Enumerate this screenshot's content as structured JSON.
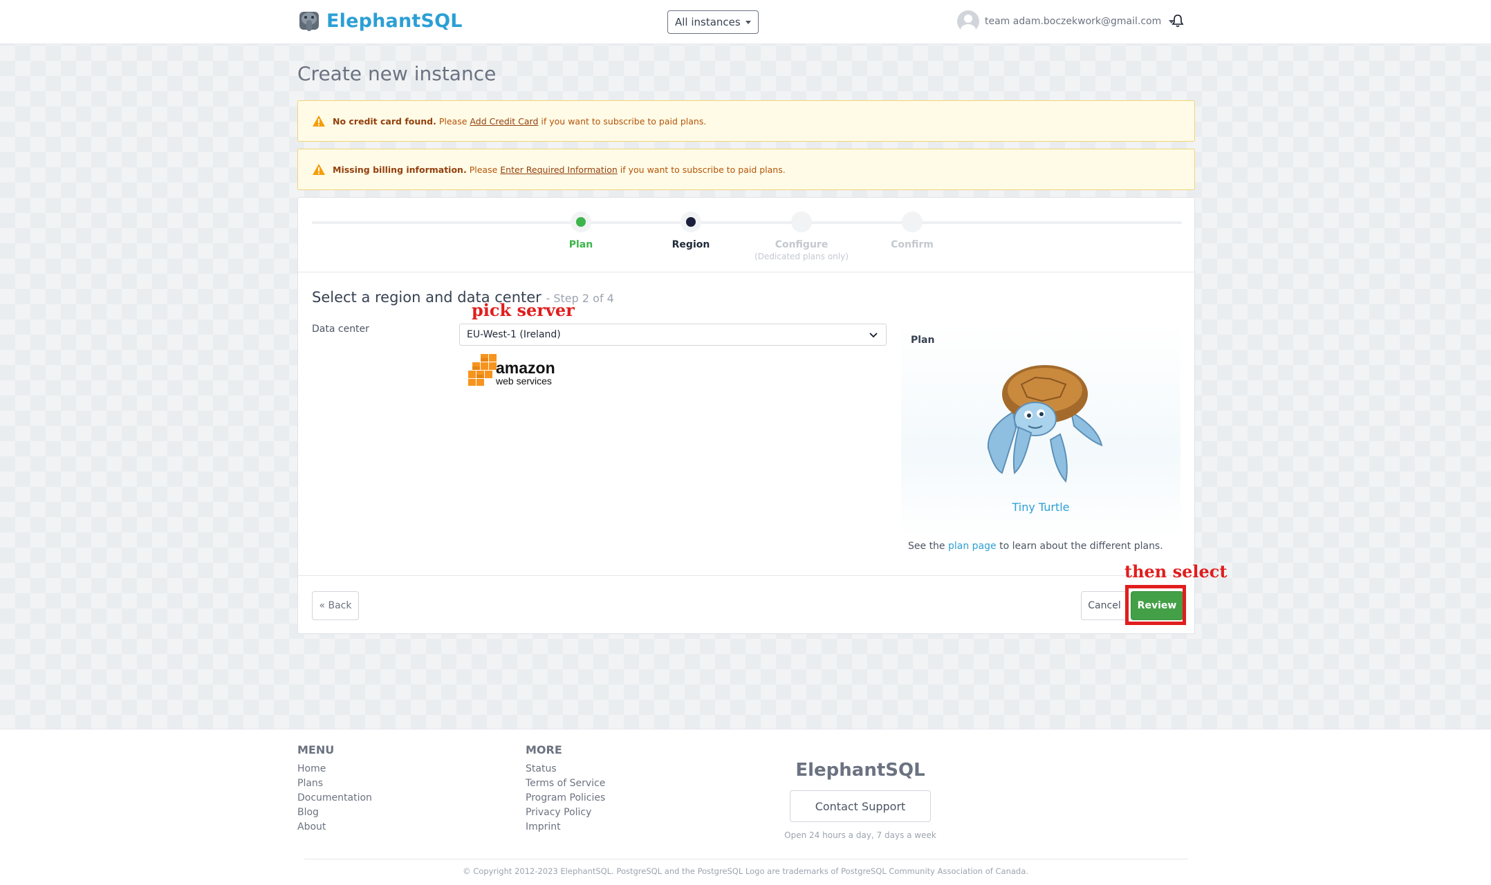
{
  "navbar": {
    "brand": "ElephantSQL",
    "instances_button": "All instances",
    "user_label": "team adam.boczekwork@gmail.com"
  },
  "page": {
    "title": "Create new instance"
  },
  "alerts": [
    {
      "bold": "No credit card found.",
      "pre": "Please",
      "link": "Add Credit Card",
      "post": "if you want to subscribe to paid plans."
    },
    {
      "bold": "Missing billing information.",
      "pre": "Please",
      "link": "Enter Required Information",
      "post": "if you want to subscribe to paid plans."
    }
  ],
  "steps": [
    {
      "label": "Plan",
      "sub": "",
      "state": "done"
    },
    {
      "label": "Region",
      "sub": "",
      "state": "active"
    },
    {
      "label": "Configure",
      "sub": "(Dedicated plans only)",
      "state": "pending"
    },
    {
      "label": "Confirm",
      "sub": "",
      "state": "pending"
    }
  ],
  "region_form": {
    "title": "Select a region and data center",
    "step_count": "- Step 2 of 4",
    "data_center_label": "Data center",
    "data_center_value": "EU-West-1 (Ireland)",
    "provider_logo": "amazon web services"
  },
  "plan": {
    "label": "Plan",
    "name": "Tiny Turtle",
    "note_pre": "See the",
    "note_link": "plan page",
    "note_post": "to learn about the different plans."
  },
  "buttons": {
    "back": "« Back",
    "cancel": "Cancel",
    "review": "Review"
  },
  "annotations": {
    "pick_server": "pick  server",
    "then_select": "then  select"
  },
  "footer": {
    "menu_title": "MENU",
    "menu_links": [
      "Home",
      "Plans",
      "Documentation",
      "Blog",
      "About"
    ],
    "more_title": "MORE",
    "more_links": [
      "Status",
      "Terms of Service",
      "Program Policies",
      "Privacy Policy",
      "Imprint"
    ],
    "brand": "ElephantSQL",
    "support_button": "Contact Support",
    "support_hours": "Open 24 hours a day, 7 days a week",
    "copyright": "© Copyright 2012-2023 ElephantSQL. PostgreSQL and the PostgreSQL Logo are trademarks of PostgreSQL Community Association of Canada."
  },
  "colors": {
    "brand_blue": "#2c9fd5",
    "success_green": "#3cb54a",
    "review_green": "#43a047",
    "active_step": "#1c1f3b",
    "annotation_red": "#e11d1d"
  },
  "icons": {
    "brand_logo": "elephant-icon",
    "bell": "bell-icon",
    "avatar": "user-avatar-icon",
    "warning": "warning-triangle-icon",
    "select": "chevron-down-icon",
    "plan_mascot": "turtle-icon"
  }
}
